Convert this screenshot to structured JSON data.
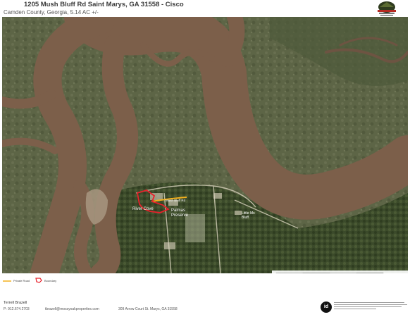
{
  "header": {
    "title": "1205 Mush Bluff Rd Saint Marys, GA 31558 - Cisco",
    "subtitle": "Camden County, Georgia, 5.14 AC +/-"
  },
  "brand": {
    "logo_icon": "mossy-oak-properties-logo"
  },
  "map": {
    "place_labels": {
      "river_cove": "River Cove",
      "palmas_preserve": "Palmas\nPreserve",
      "mush_bluff": "Mush Bluff Rd",
      "bluff_area": "Little Ms\nBluff"
    },
    "scale": {
      "ticks": [
        "0",
        "1000",
        "2000",
        "3000",
        "4000ft"
      ]
    }
  },
  "legend": {
    "items": [
      {
        "label": "Private Road",
        "color": "#f2b01e",
        "icon": "yellow-line-icon"
      },
      {
        "label": "Boundary",
        "color": "#e8212b",
        "icon": "red-outline-icon"
      }
    ]
  },
  "footer": {
    "agent_name": "Terrell Brazell",
    "agent_phone": "P: 912.674.2703",
    "agent_email": "tbrazell@mossyoakproperties.com",
    "agent_address": "309 Arrow Court St. Marys, GA 31558",
    "id_logo": "id"
  },
  "colors": {
    "river": "#7c5f4a",
    "marsh": "#5f6748",
    "forest": "#3d4a2c",
    "boundary": "#e8212b",
    "road": "#f2b01e"
  }
}
